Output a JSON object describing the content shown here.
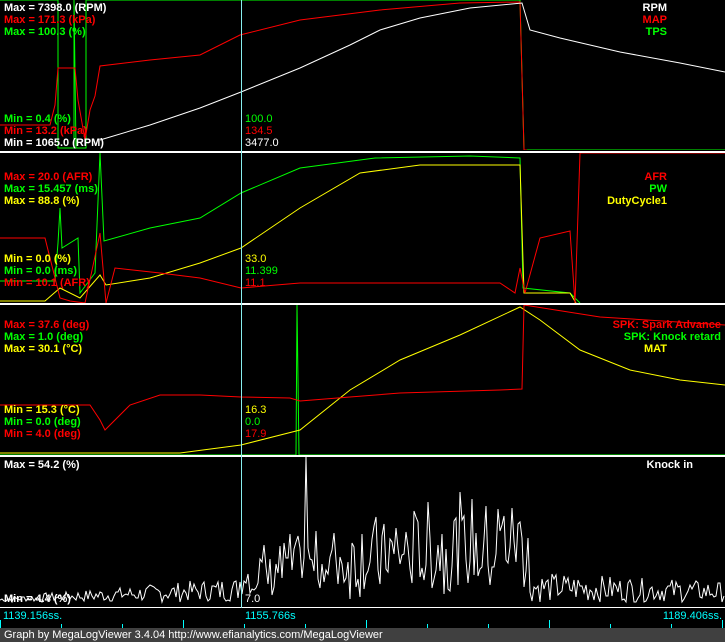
{
  "panel1": {
    "max": [
      "Max = 7398.0 (RPM)",
      "Max = 171.3 (kPa)",
      "Max = 100.3 (%)"
    ],
    "min": [
      "Min = 0.4 (%)",
      "Min = 13.2 (kPa)",
      "Min = 1065.0 (RPM)"
    ],
    "legend": [
      "RPM",
      "MAP",
      "TPS"
    ],
    "cursor": [
      "100.0",
      "134.5",
      "3477.0"
    ]
  },
  "panel2": {
    "max": [
      "Max = 20.0 (AFR)",
      "Max = 15.457 (ms)",
      "Max = 88.8 (%)"
    ],
    "min": [
      "Min = 0.0 (%)",
      "Min = 0.0 (ms)",
      "Min = 10.1 (AFR)"
    ],
    "legend": [
      "AFR",
      "PW",
      "DutyCycle1"
    ],
    "cursor": [
      "33.0",
      "11.399",
      "11.1"
    ]
  },
  "panel3": {
    "max": [
      "Max = 37.6 (deg)",
      "Max = 1.0 (deg)",
      "Max = 30.1 (°C)"
    ],
    "min": [
      "Min = 15.3 (°C)",
      "Min = 0.0 (deg)",
      "Min = 4.0 (deg)"
    ],
    "legend": [
      "SPK: Spark Advance",
      "SPK: Knock retard",
      "MAT"
    ],
    "cursor": [
      "16.3",
      "0.0",
      "17.9"
    ]
  },
  "panel4": {
    "max": [
      "Max = 54.2 (%)"
    ],
    "min": [
      "Min = 4.4 (%)"
    ],
    "legend": [
      "Knock in"
    ],
    "cursor": [
      "7.0"
    ]
  },
  "axis": {
    "start": "1139.156ss.",
    "cursor": "1155.766s",
    "end": "1189.406ss."
  },
  "footer": "Graph by MegaLogViewer 3.4.04 http://www.efianalytics.com/MegaLogViewer",
  "colors": {
    "rpm": "#ffffff",
    "map": "#ff0000",
    "tps": "#00ff00",
    "cursor": "#88eeee",
    "axis": "#00ffff"
  }
}
